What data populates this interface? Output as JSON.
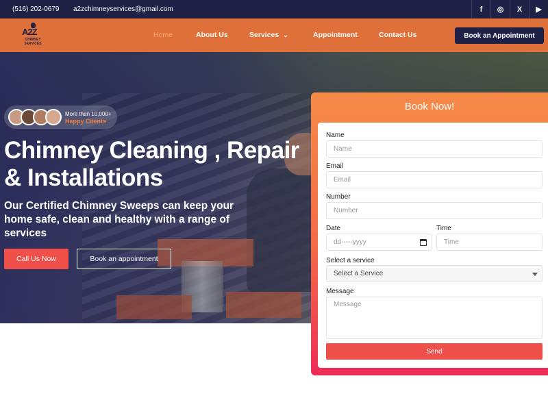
{
  "topbar": {
    "phone": "(516) 202-0679",
    "email": "a2zchimneyservices@gmail.com",
    "social": [
      {
        "icon": "facebook-icon",
        "glyph": "f"
      },
      {
        "icon": "instagram-icon",
        "glyph": "◎"
      },
      {
        "icon": "x-twitter-icon",
        "glyph": "X"
      },
      {
        "icon": "youtube-icon",
        "glyph": "▶"
      }
    ]
  },
  "nav": {
    "logo": {
      "main": "A2Z",
      "sub": "CHIMNEY SERVICES"
    },
    "items": [
      "Home",
      "About Us",
      "Services",
      "Appointment",
      "Contact Us"
    ],
    "cta": "Book an Appointment",
    "colors": {
      "nav_bg": "#e0703a",
      "dark": "#1f2147",
      "active": "#f5a96f"
    }
  },
  "hero": {
    "clients_line1": "More than 10,000+",
    "clients_line2": "Happy Clients",
    "headline": "Chimney Cleaning , Repair & Installations",
    "subheadline": "Our Certified Chimney Sweeps can keep your home safe, clean and healthy with a range of services",
    "btn_call": "Call Us Now",
    "btn_book": "Book an appointment"
  },
  "form": {
    "title": "Book Now!",
    "name_label": "Name",
    "name_placeholder": "Name",
    "email_label": "Email",
    "email_placeholder": "Email",
    "number_label": "Number",
    "number_placeholder": "Number",
    "date_label": "Date",
    "date_placeholder": "dd-----yyyy",
    "time_label": "Time",
    "time_placeholder": "Time",
    "service_label": "Select a service",
    "service_value": "Select a Service",
    "message_label": "Message",
    "message_placeholder": "Message",
    "send": "Send"
  }
}
